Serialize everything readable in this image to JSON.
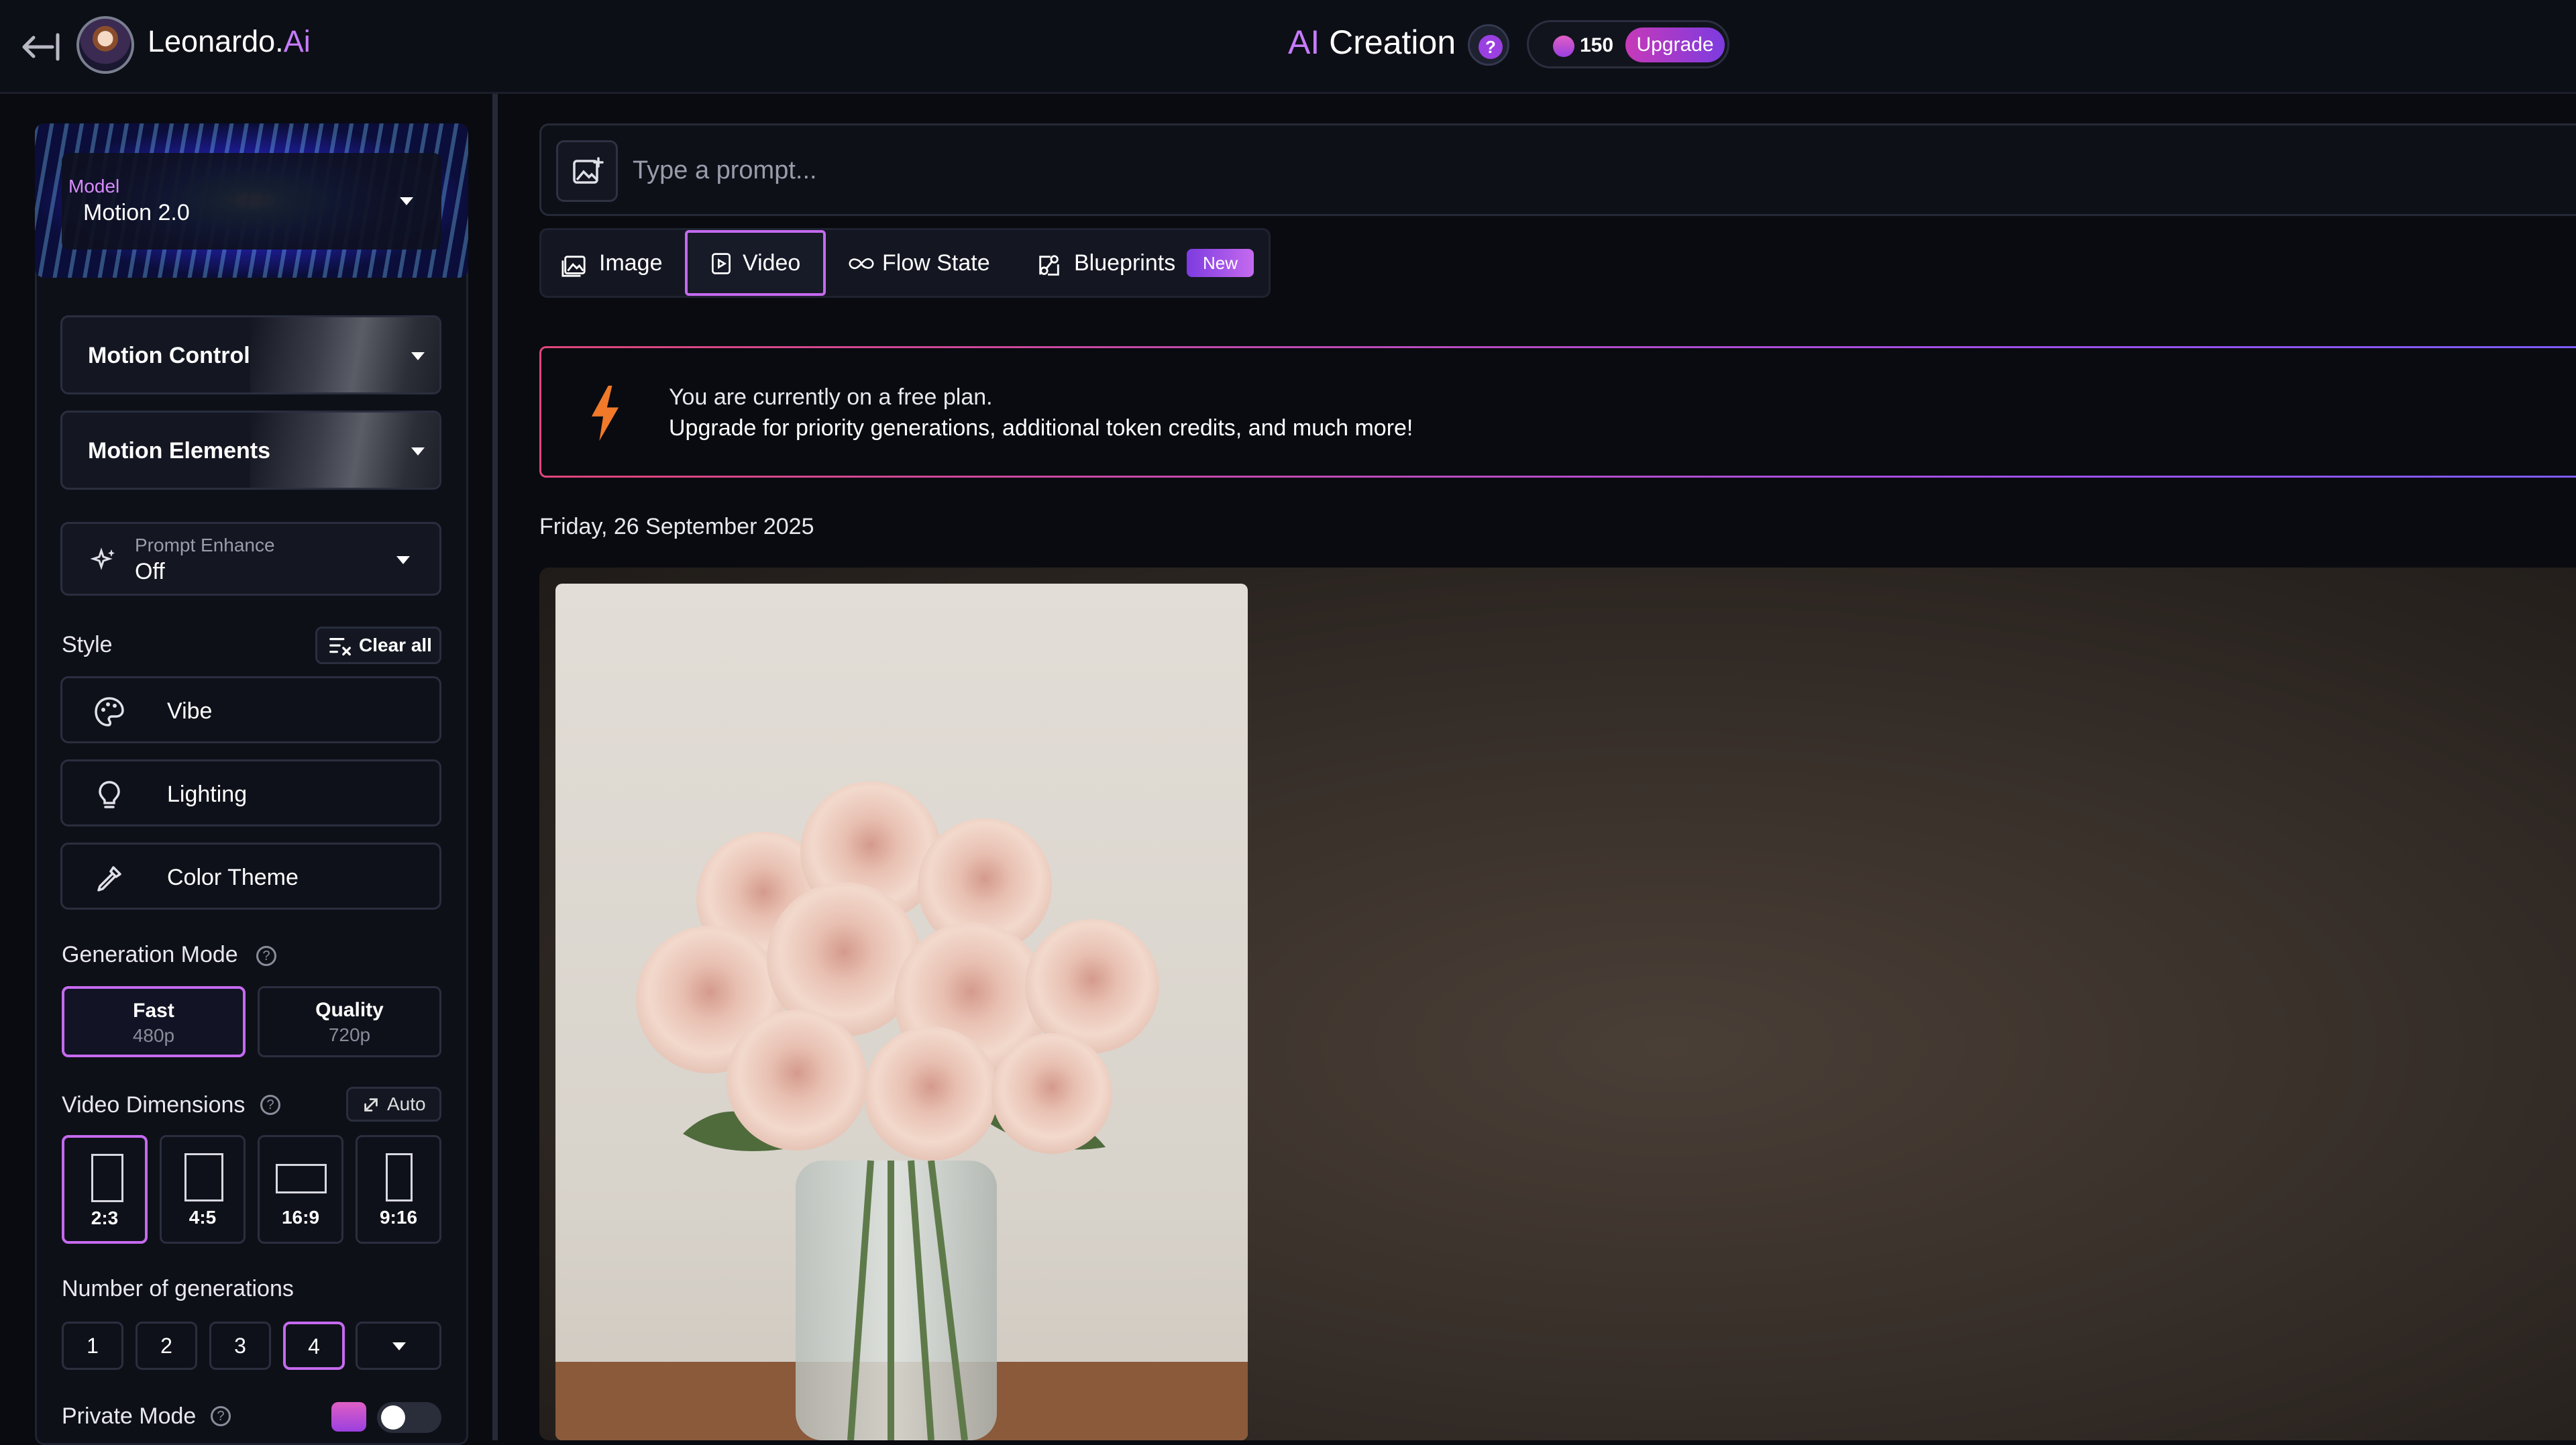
{
  "brand": {
    "name": "Leonardo.",
    "accent": "Ai"
  },
  "header": {
    "title_accent": "AI",
    "title_rest": " Creation",
    "help_symbol": "?",
    "tokens": "150",
    "upgrade_label": "Upgrade"
  },
  "sidebar": {
    "model": {
      "label": "Model",
      "value": "Motion 2.0"
    },
    "motion_control": "Motion Control",
    "motion_elements": "Motion Elements",
    "prompt_enhance": {
      "label": "Prompt Enhance",
      "value": "Off"
    },
    "style": {
      "label": "Style",
      "clear_all": "Clear all",
      "items": [
        {
          "label": "Vibe",
          "icon": "palette-icon"
        },
        {
          "label": "Lighting",
          "icon": "lightbulb-icon"
        },
        {
          "label": "Color Theme",
          "icon": "eyedropper-icon"
        }
      ]
    },
    "generation_mode": {
      "label": "Generation Mode",
      "options": [
        {
          "name": "Fast",
          "res": "480p",
          "selected": true
        },
        {
          "name": "Quality",
          "res": "720p",
          "selected": false
        }
      ]
    },
    "video_dimensions": {
      "label": "Video Dimensions",
      "auto_label": "Auto",
      "options": [
        "2:3",
        "4:5",
        "16:9",
        "9:16"
      ],
      "selected": "2:3"
    },
    "num_generations": {
      "label": "Number of generations",
      "options": [
        "1",
        "2",
        "3",
        "4"
      ],
      "selected": "4"
    },
    "private_mode": {
      "label": "Private Mode",
      "enabled": false
    }
  },
  "main": {
    "prompt_placeholder": "Type a prompt...",
    "tabs": [
      {
        "label": "Image",
        "icon": "image-icon"
      },
      {
        "label": "Video",
        "icon": "video-icon",
        "selected": true
      },
      {
        "label": "Flow State",
        "icon": "infinity-icon"
      },
      {
        "label": "Blueprints",
        "icon": "blueprint-icon",
        "badge": "New"
      }
    ],
    "banner": {
      "line1": "You are currently on a free plan.",
      "line2": "Upgrade for priority generations, additional token credits, and much more!"
    },
    "date": "Friday, 26 September 2025"
  },
  "colors": {
    "accent": "#c56aef",
    "brand_ai": "#c67bff",
    "bolt": "#f07a2a",
    "background": "#0a0b10"
  }
}
